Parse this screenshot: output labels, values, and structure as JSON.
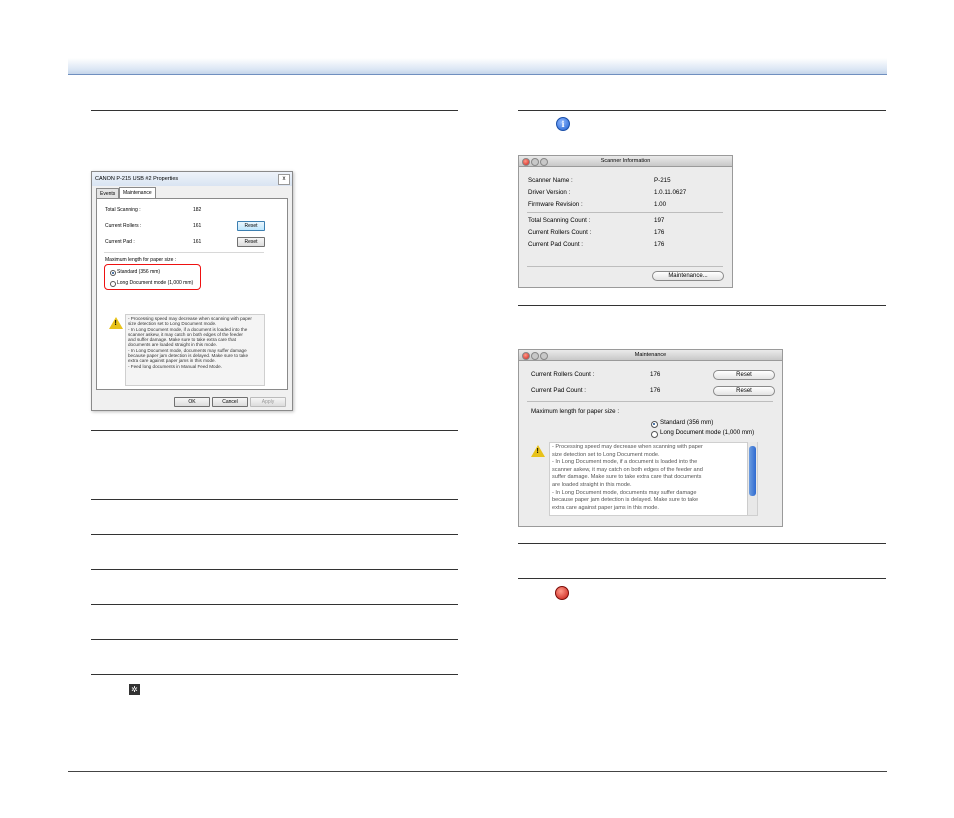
{
  "win_dialog": {
    "title": "CANON P-215 USB #2 Properties",
    "close_glyph": "x",
    "tabs": [
      "Events",
      "Maintenance"
    ],
    "rows": [
      {
        "label": "Total Scanning :",
        "value": "182"
      },
      {
        "label": "Current Rollers :",
        "value": "161"
      },
      {
        "label": "Current Pad :",
        "value": "161"
      }
    ],
    "reset_label": "Reset",
    "paper_size_label": "Maximum length for paper size :",
    "options": [
      "Standard (356 mm)",
      "Long Document mode (1,000 mm)"
    ],
    "warning_lines": [
      "- Processing speed may decrease when scanning with paper",
      "size detection set to Long Document mode.",
      "- In Long Document mode, if a document is loaded into the",
      "scanner askew, it may catch on both edges of the feeder",
      "and suffer damage. Make sure to take extra care that",
      "documents are loaded straight in this mode.",
      "- In Long Document mode, documents may suffer damage",
      "because paper jam detection is delayed. Make sure to take",
      "extra care against paper jams in this mode.",
      "- Feed long documents in Manual Feed Mode."
    ],
    "buttons": {
      "ok": "OK",
      "cancel": "Cancel",
      "apply": "Apply"
    }
  },
  "scanner_info": {
    "title": "Scanner Information",
    "rows1": [
      {
        "label": "Scanner Name :",
        "value": "P-215"
      },
      {
        "label": "Driver Version :",
        "value": "1.0.11.0627"
      },
      {
        "label": "Firmware Revision :",
        "value": "1.00"
      }
    ],
    "rows2": [
      {
        "label": "Total Scanning Count :",
        "value": "197"
      },
      {
        "label": "Current Rollers Count :",
        "value": "176"
      },
      {
        "label": "Current Pad Count :",
        "value": "176"
      }
    ],
    "maintenance_button": "Maintenance..."
  },
  "mac_maintenance": {
    "title": "Maintenance",
    "rows": [
      {
        "label": "Current Rollers Count :",
        "value": "176"
      },
      {
        "label": "Current Pad Count :",
        "value": "176"
      }
    ],
    "reset_label": "Reset",
    "paper_size_label": "Maximum length for paper size :",
    "options": [
      "Standard (356 mm)",
      "Long Document mode (1,000 mm)"
    ],
    "warning_lines": [
      "- Processing speed may decrease when scanning with paper",
      "size detection set to Long Document mode.",
      "- In Long Document mode, if a document is loaded into the",
      "scanner askew, it may catch on both edges of the feeder and",
      "suffer damage. Make sure to take extra care that documents",
      "are loaded straight in this mode.",
      "- In Long Document mode, documents may suffer damage",
      "because paper jam detection is delayed. Make sure to take",
      "extra care against paper jams in this mode."
    ]
  },
  "icons": {
    "info": "i",
    "warning": "!",
    "gear": "✲"
  },
  "colors": {
    "highlight": "#e11111",
    "header_band": "#c5d5ea",
    "scroll_thumb": "#2f6ad0"
  }
}
